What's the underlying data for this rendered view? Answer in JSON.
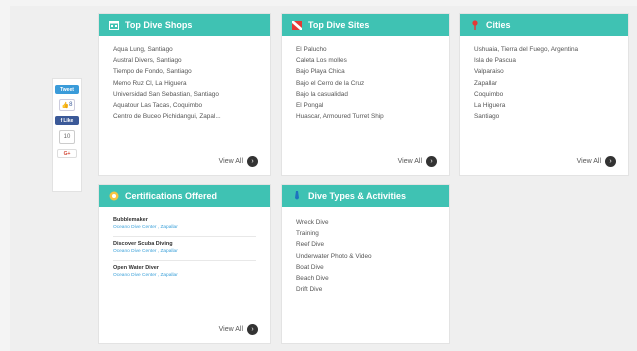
{
  "social": {
    "tweet_label": "Tweet",
    "like_count": "8",
    "like_label": "Like",
    "share_count": "10",
    "gplus_label": "G+"
  },
  "shops": {
    "title": "Top Dive Shops",
    "items": [
      "Aqua Lung, Santiago",
      "Austral Divers, Santiago",
      "Tiempo de Fondo, Santiago",
      "Memo Ruz Cl, La Higuera",
      "Universidad San Sebastian, Santiago",
      "Aquatour Las Tacas, Coquimbo",
      "Centro de Buceo Pichidangui, Zapal..."
    ],
    "view_all": "View All"
  },
  "sites": {
    "title": "Top Dive Sites",
    "items": [
      "El Palucho",
      "Caleta Los molles",
      "Bajo Playa Chica",
      "Bajo el Cerro de la Cruz",
      "Bajo la casualidad",
      "El Pongal",
      "Huascar, Armoured Turret Ship"
    ],
    "view_all": "View All"
  },
  "cities": {
    "title": "Cities",
    "items": [
      "Ushuaia, Tierra del Fuego, Argentina",
      "Isla de Pascua",
      "Valparaiso",
      "Zapallar",
      "Coquimbo",
      "La Higuera",
      "Santiago"
    ],
    "view_all": "View All"
  },
  "certs": {
    "title": "Certifications Offered",
    "items": [
      {
        "title": "Bubblemaker",
        "links": "Oceano Dive Center , Zapallar"
      },
      {
        "title": "Discover Scuba Diving",
        "links": "Oceano Dive Center , Zapallar"
      },
      {
        "title": "Open Water Diver",
        "links": "Oceano Dive Center , Zapallar"
      }
    ],
    "view_all": "View All"
  },
  "types": {
    "title": "Dive Types & Activities",
    "items": [
      "Wreck Dive",
      "Training",
      "Reef Dive",
      "Underwater Photo & Video",
      "Boat Dive",
      "Beach Dive",
      "Drift Dive"
    ]
  },
  "colors": {
    "header_teal": "#3fc2b3",
    "link_blue": "#3aa0d9"
  }
}
